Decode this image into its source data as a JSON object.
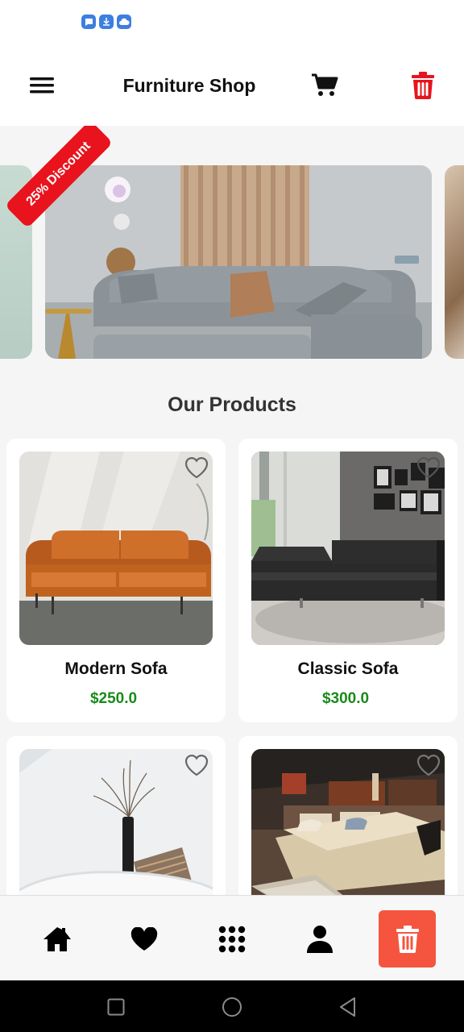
{
  "app": {
    "title": "Furniture Shop"
  },
  "carousel": {
    "badge": "25% Discount"
  },
  "section": {
    "title": "Our Products"
  },
  "products": [
    {
      "name": "Modern Sofa",
      "price": "$250.0"
    },
    {
      "name": "Classic Sofa",
      "price": "$300.0"
    },
    {
      "name": "",
      "price": ""
    },
    {
      "name": "",
      "price": ""
    }
  ],
  "bottom_nav": {
    "items": [
      "home-icon",
      "heart-icon",
      "grid-icon",
      "person-icon",
      "trash-icon"
    ],
    "active_index": 4
  },
  "colors": {
    "accent": "#f5543f",
    "price": "#1a8a1a",
    "badge": "#e8131c",
    "trash_top": "#e8131c"
  },
  "icons": {
    "status": [
      "chat-notification-icon",
      "download-icon",
      "cloud-icon"
    ],
    "app_bar": [
      "menu-icon",
      "cart-icon",
      "trash-icon"
    ],
    "system_nav": [
      "recents-icon",
      "home-circle-icon",
      "back-icon"
    ]
  }
}
